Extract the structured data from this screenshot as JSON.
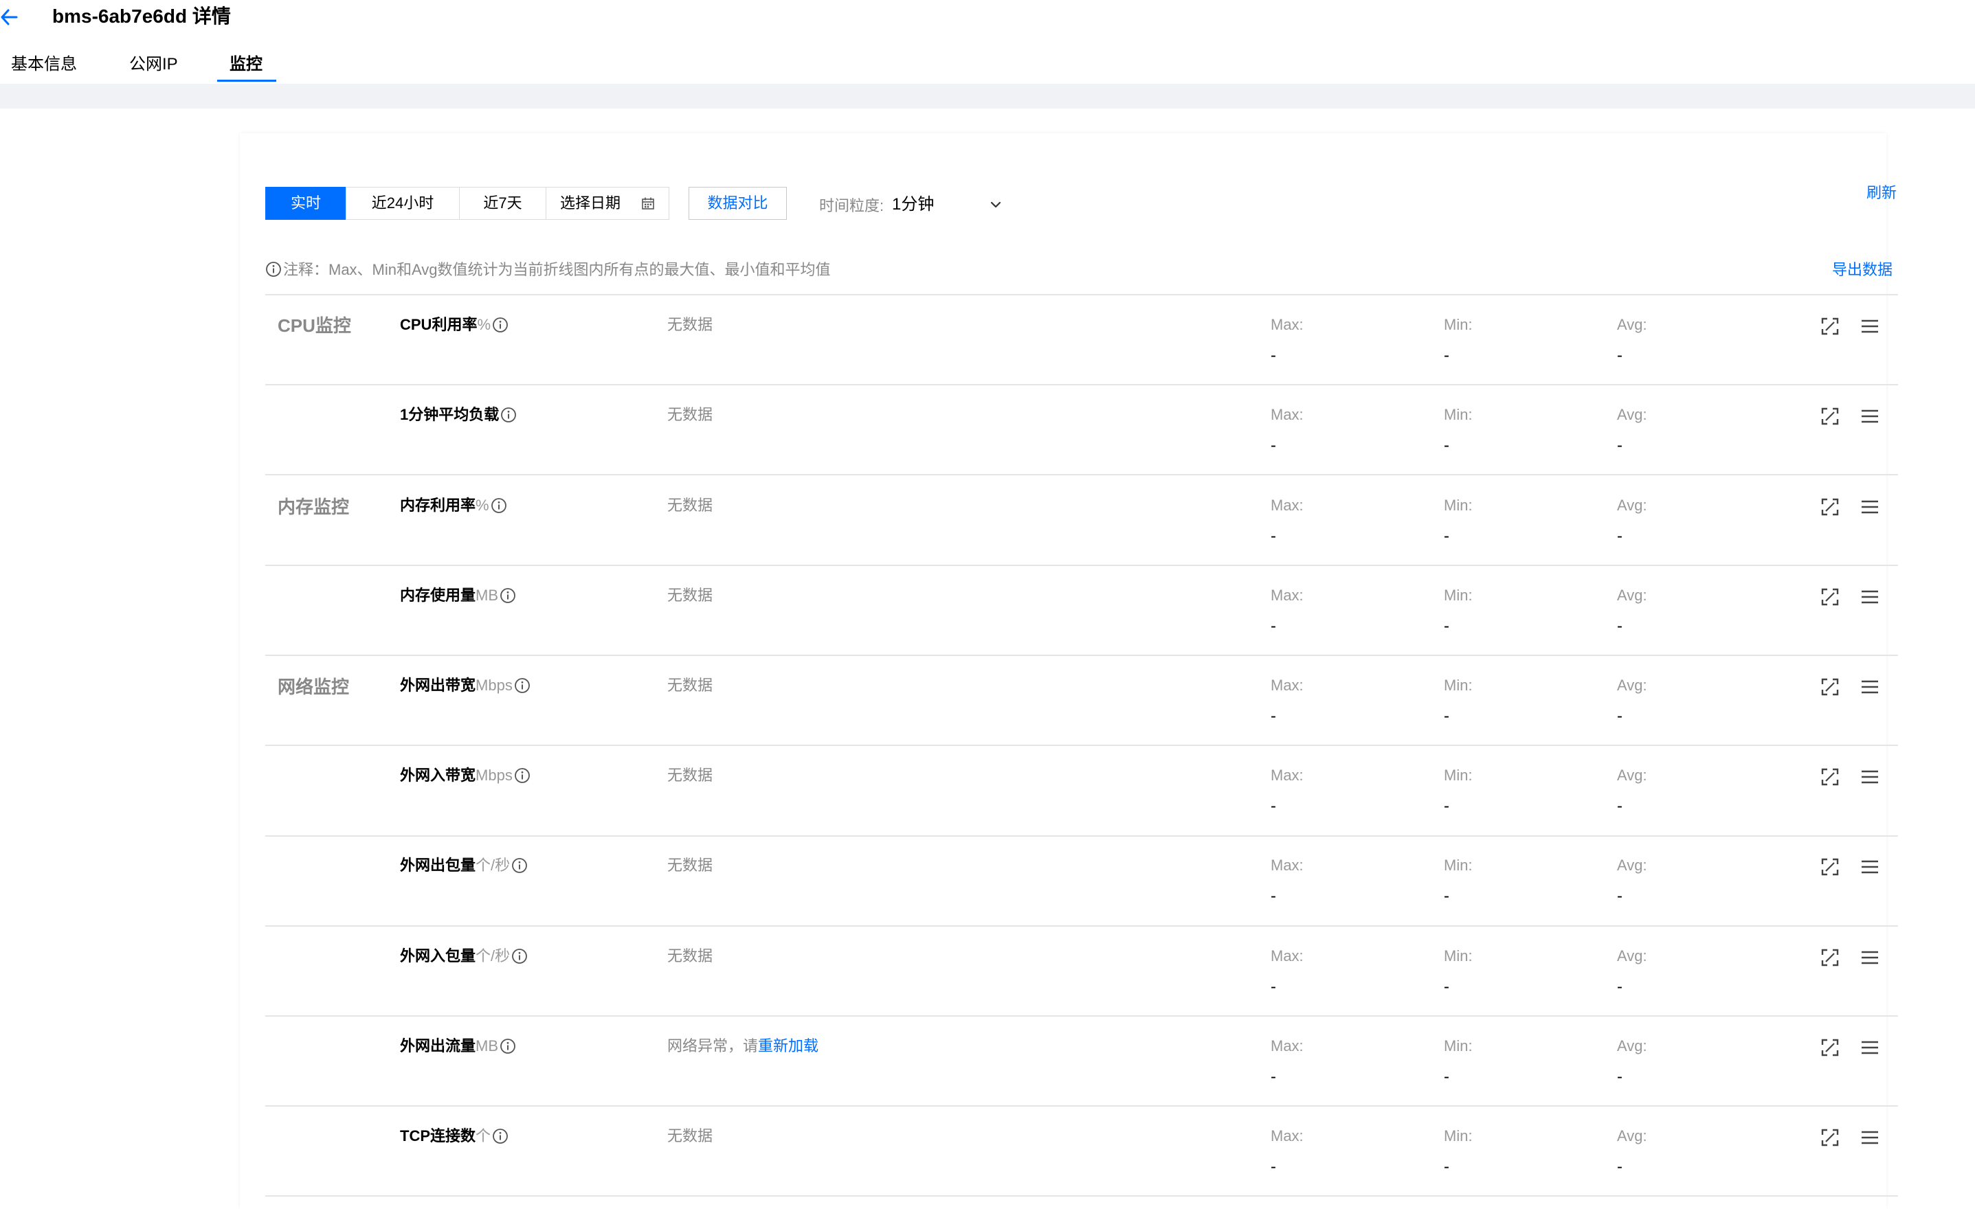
{
  "header": {
    "title": "bms-6ab7e6dd 详情",
    "back_icon": "arrow-left-icon",
    "accent_color": "#006eff"
  },
  "tabs": [
    {
      "label": "基本信息",
      "active": false
    },
    {
      "label": "公网IP",
      "active": false
    },
    {
      "label": "监控",
      "active": true
    }
  ],
  "toolbar": {
    "time_ranges": [
      "实时",
      "近24小时",
      "近7天",
      "选择日期"
    ],
    "active_range": "实时",
    "date_icon": "calendar-icon",
    "compare_label": "数据对比",
    "granularity_label": "时间粒度:",
    "granularity_value": "1分钟",
    "refresh_label": "刷新"
  },
  "note": {
    "text": "注释：Max、Min和Avg数值统计为当前折线图内所有点的最大值、最小值和平均值",
    "export_label": "导出数据"
  },
  "stat_labels": {
    "max": "Max:",
    "min": "Min:",
    "avg": "Avg:"
  },
  "groups": [
    {
      "label": "CPU监控",
      "metrics": [
        {
          "name": "CPU利用率",
          "unit": "%",
          "status": "无数据",
          "max": "-",
          "min": "-",
          "avg": "-"
        },
        {
          "name": "1分钟平均负载",
          "unit": "",
          "status": "无数据",
          "max": "-",
          "min": "-",
          "avg": "-"
        }
      ]
    },
    {
      "label": "内存监控",
      "metrics": [
        {
          "name": "内存利用率",
          "unit": "%",
          "status": "无数据",
          "max": "-",
          "min": "-",
          "avg": "-"
        },
        {
          "name": "内存使用量",
          "unit": "MB",
          "status": "无数据",
          "max": "-",
          "min": "-",
          "avg": "-"
        }
      ]
    },
    {
      "label": "网络监控",
      "metrics": [
        {
          "name": "外网出带宽",
          "unit": "Mbps",
          "status": "无数据",
          "max": "-",
          "min": "-",
          "avg": "-"
        },
        {
          "name": "外网入带宽",
          "unit": "Mbps",
          "status": "无数据",
          "max": "-",
          "min": "-",
          "avg": "-"
        },
        {
          "name": "外网出包量",
          "unit": "个/秒",
          "status": "无数据",
          "max": "-",
          "min": "-",
          "avg": "-"
        },
        {
          "name": "外网入包量",
          "unit": "个/秒",
          "status": "无数据",
          "max": "-",
          "min": "-",
          "avg": "-"
        },
        {
          "name": "外网出流量",
          "unit": "MB",
          "status": "网络异常，请",
          "reload_link": "重新加载",
          "max": "-",
          "min": "-",
          "avg": "-"
        },
        {
          "name": "TCP连接数",
          "unit": "个",
          "status": "无数据",
          "max": "-",
          "min": "-",
          "avg": "-"
        }
      ]
    }
  ]
}
